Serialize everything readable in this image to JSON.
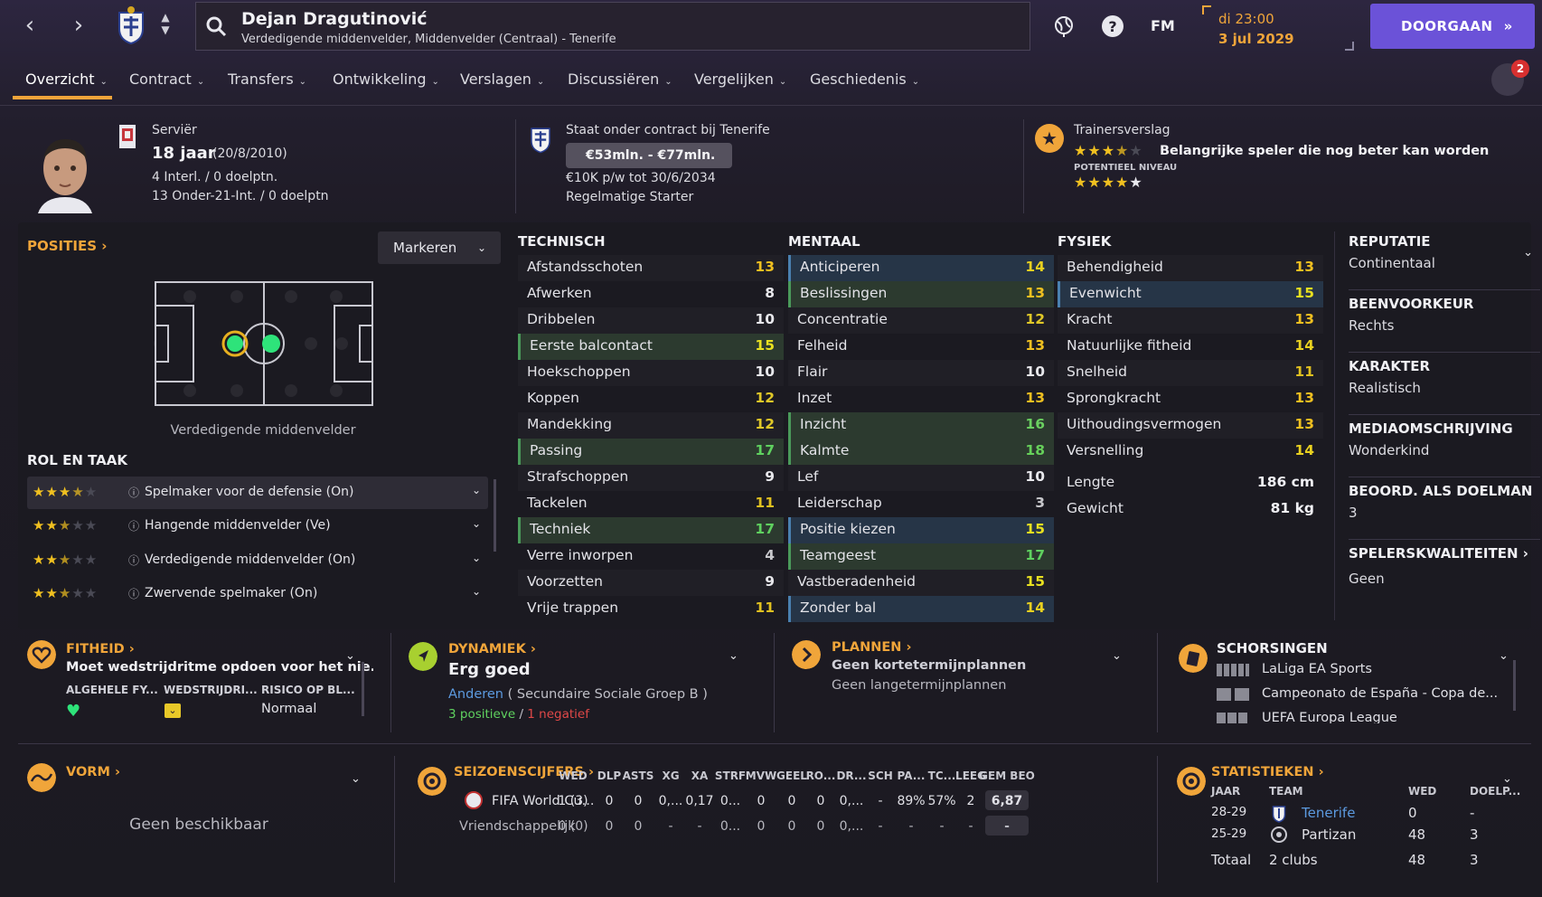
{
  "header": {
    "player_name": "Dejan Dragutinović",
    "player_sub": "Verdedigende middenvelder, Middenvelder (Centraal) - Tenerife",
    "fm": "FM",
    "date_time": "di 23:00",
    "date": "3 jul 2029",
    "continue": "DOORGAAN",
    "badge_count": "2"
  },
  "tabs": [
    "Overzicht",
    "Contract",
    "Transfers",
    "Ontwikkeling",
    "Verslagen",
    "Discussiëren",
    "Vergelijken",
    "Geschiedenis"
  ],
  "info": {
    "nationality": "Serviër",
    "age": "18 jaar",
    "dob": "(20/8/2010)",
    "caps": "4 Interl. / 0 doelptn.",
    "u21": "13 Onder-21-Int. / 0 doelptn",
    "contract_title": "Staat onder contract bij Tenerife",
    "value": "€53mln. - €77mln.",
    "wage": "€10K p/w tot 30/6/2034",
    "status": "Regelmatige Starter",
    "report_title": "Trainersverslag",
    "report_text": "Belangrijke speler die nog beter kan worden",
    "potential_label": "POTENTIEEL NIVEAU",
    "current_stars": 3.5,
    "potential_stars": 4.5
  },
  "positions": {
    "title": "POSITIES",
    "mark_btn": "Markeren",
    "position_label": "Verdedigende middenvelder",
    "role_title": "ROL EN TAAK",
    "roles": [
      {
        "name": "Spelmaker voor de defensie (On)",
        "stars": 3.5
      },
      {
        "name": "Hangende middenvelder (Ve)",
        "stars": 2.5
      },
      {
        "name": "Verdedigende middenvelder (On)",
        "stars": 2.5
      },
      {
        "name": "Zwervende spelmaker (On)",
        "stars": 2.5
      }
    ]
  },
  "technisch": {
    "title": "TECHNISCH",
    "rows": [
      [
        "Afstandsschoten",
        "13",
        ""
      ],
      [
        "Afwerken",
        "8",
        ""
      ],
      [
        "Dribbelen",
        "10",
        ""
      ],
      [
        "Eerste balcontact",
        "15",
        "grn"
      ],
      [
        "Hoekschoppen",
        "10",
        ""
      ],
      [
        "Koppen",
        "12",
        ""
      ],
      [
        "Mandekking",
        "12",
        ""
      ],
      [
        "Passing",
        "17",
        "grn"
      ],
      [
        "Strafschoppen",
        "9",
        ""
      ],
      [
        "Tackelen",
        "11",
        ""
      ],
      [
        "Techniek",
        "17",
        "grn"
      ],
      [
        "Verre inworpen",
        "4",
        ""
      ],
      [
        "Voorzetten",
        "9",
        ""
      ],
      [
        "Vrije trappen",
        "11",
        ""
      ]
    ]
  },
  "mentaal": {
    "title": "MENTAAL",
    "rows": [
      [
        "Anticiperen",
        "14",
        "blu"
      ],
      [
        "Beslissingen",
        "13",
        "grn"
      ],
      [
        "Concentratie",
        "12",
        ""
      ],
      [
        "Felheid",
        "13",
        ""
      ],
      [
        "Flair",
        "10",
        ""
      ],
      [
        "Inzet",
        "13",
        ""
      ],
      [
        "Inzicht",
        "16",
        "grn"
      ],
      [
        "Kalmte",
        "18",
        "grn"
      ],
      [
        "Lef",
        "10",
        ""
      ],
      [
        "Leiderschap",
        "3",
        ""
      ],
      [
        "Positie kiezen",
        "15",
        "blu"
      ],
      [
        "Teamgeest",
        "17",
        "grn"
      ],
      [
        "Vastberadenheid",
        "15",
        ""
      ],
      [
        "Zonder bal",
        "14",
        "blu"
      ]
    ]
  },
  "fysiek": {
    "title": "FYSIEK",
    "rows": [
      [
        "Behendigheid",
        "13",
        ""
      ],
      [
        "Evenwicht",
        "15",
        "blu"
      ],
      [
        "Kracht",
        "13",
        ""
      ],
      [
        "Natuurlijke fitheid",
        "14",
        ""
      ],
      [
        "Snelheid",
        "11",
        ""
      ],
      [
        "Sprongkracht",
        "13",
        ""
      ],
      [
        "Uithoudingsvermogen",
        "13",
        ""
      ],
      [
        "Versnelling",
        "14",
        ""
      ]
    ],
    "length_label": "Lengte",
    "length": "186 cm",
    "weight_label": "Gewicht",
    "weight": "81 kg"
  },
  "right": [
    {
      "h": "REPUTATIE",
      "t": "Continentaal"
    },
    {
      "h": "BEENVOORKEUR",
      "t": "Rechts"
    },
    {
      "h": "KARAKTER",
      "t": "Realistisch"
    },
    {
      "h": "MEDIAOMSCHRIJVING",
      "t": "Wonderkind"
    },
    {
      "h": "BEOORD. ALS DOELMAN",
      "t": "3"
    },
    {
      "h": "SPELERSKWALITEITEN",
      "t": "Geen"
    }
  ],
  "fitness": {
    "title": "FITHEID",
    "text": "Moet wedstrijdritme opdoen voor het nie..",
    "c1": "ALGEHELE FY...",
    "c2": "WEDSTRIJDRI...",
    "c3": "RISICO OP BL...",
    "c3v": "Normaal"
  },
  "dynamics": {
    "title": "DYNAMIEK",
    "value": "Erg goed",
    "group": "Anderen",
    "group_sub": "( Secundaire Sociale Groep B )",
    "pos": "3 positieve",
    "sep": "/",
    "neg": "1 negatief"
  },
  "plans": {
    "title": "PLANNEN",
    "short": "Geen kortetermijnplannen",
    "long": "Geen langetermijnplannen"
  },
  "suspensions": {
    "title": "SCHORSINGEN",
    "items": [
      "LaLiga EA Sports",
      "Campeonato de España - Copa de...",
      "UEFA Europa League"
    ]
  },
  "form": {
    "title": "VORM",
    "text": "Geen beschikbaar"
  },
  "season": {
    "title": "SEIZOENSCIJFERS",
    "cols": [
      "WED",
      "DLP",
      "ASTS",
      "XG",
      "XA",
      "STRF",
      "MVW",
      "GEEL",
      "RO...",
      "DR...",
      "SCH",
      "PA...",
      "TC...",
      "LEEG",
      "GEM BEO"
    ],
    "rows": [
      [
        "FIFA World Cu...",
        "1 (3)",
        "0",
        "0",
        "0,...",
        "0,17",
        "0...",
        "0",
        "0",
        "0",
        "0,...",
        "-",
        "89%",
        "57%",
        "2",
        "6,87"
      ],
      [
        "Vriendschappelijk",
        "0 (0)",
        "0",
        "0",
        "-",
        "-",
        "0...",
        "0",
        "0",
        "0",
        "0,...",
        "-",
        "-",
        "-",
        "-",
        "-"
      ]
    ]
  },
  "stats": {
    "title": "STATISTIEKEN",
    "h_year": "JAAR",
    "h_team": "TEAM",
    "h_wed": "WED",
    "h_goals": "DOELP...",
    "rows": [
      [
        "28-29",
        "Tenerife",
        "0",
        "-"
      ],
      [
        "25-29",
        "Partizan",
        "48",
        "3"
      ]
    ],
    "total_label": "Totaal",
    "total_clubs": "2 clubs",
    "total_wed": "48",
    "total_goals": "3"
  }
}
